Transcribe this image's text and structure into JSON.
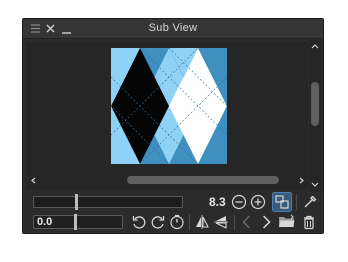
{
  "window": {
    "title": "Sub View"
  },
  "icons": {
    "menu": "hamburger-icon",
    "close": "close-icon",
    "minimize": "minimize-icon",
    "zoom_out": "zoom-out-icon",
    "zoom_in": "zoom-in-icon",
    "fit": "fit-to-window-icon",
    "eyedropper": "eyedropper-icon",
    "rotate_left": "rotate-left-icon",
    "rotate_right": "rotate-right-icon",
    "reset_rotation": "reset-rotation-icon",
    "flip_h": "flip-horizontal-icon",
    "flip_v": "flip-vertical-icon",
    "prev": "previous-image-icon",
    "next": "next-image-icon",
    "open": "open-folder-icon",
    "delete": "trash-icon"
  },
  "zoom": {
    "value": "8.3",
    "slider_fraction": 0.28
  },
  "rotation": {
    "value": "0.0",
    "slider_fraction": 0.46
  },
  "colors": {
    "panel_bg": "#2b2b2b",
    "pattern_black": "#050505",
    "pattern_white": "#ffffff",
    "pattern_dark_blue": "#3f8fc0",
    "pattern_light_blue": "#8fd2f5",
    "pattern_line": "#2f6e9c",
    "fit_active": "#4a7fb5"
  }
}
